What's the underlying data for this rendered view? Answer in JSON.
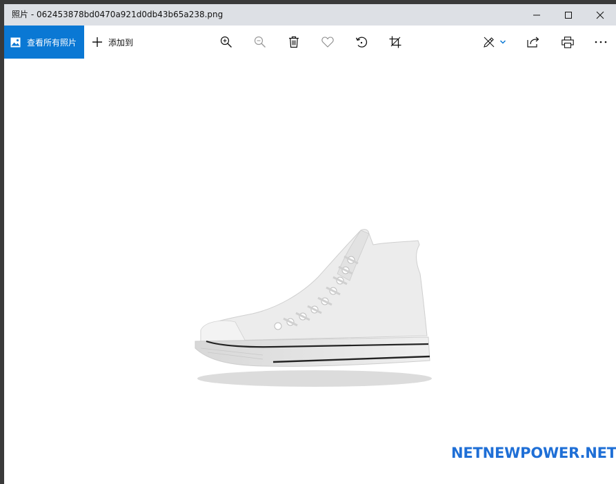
{
  "window": {
    "title": "照片 - 062453878bd0470a921d0db43b65a238.png"
  },
  "toolbar": {
    "view_all_label": "查看所有照片",
    "add_to_label": "添加到",
    "icons": [
      "zoom-in-icon",
      "zoom-out-icon",
      "delete-icon",
      "favorite-icon",
      "rotate-icon",
      "crop-icon",
      "edit-icon",
      "share-icon",
      "print-icon",
      "more-icon"
    ]
  },
  "image": {
    "description_icon": "high-top-sneaker",
    "watermark": "NETNEWPOWER.NET"
  },
  "colors": {
    "accent": "#0a78d4",
    "titlebar": "#dde0e5",
    "watermark": "#1f6fd6"
  }
}
